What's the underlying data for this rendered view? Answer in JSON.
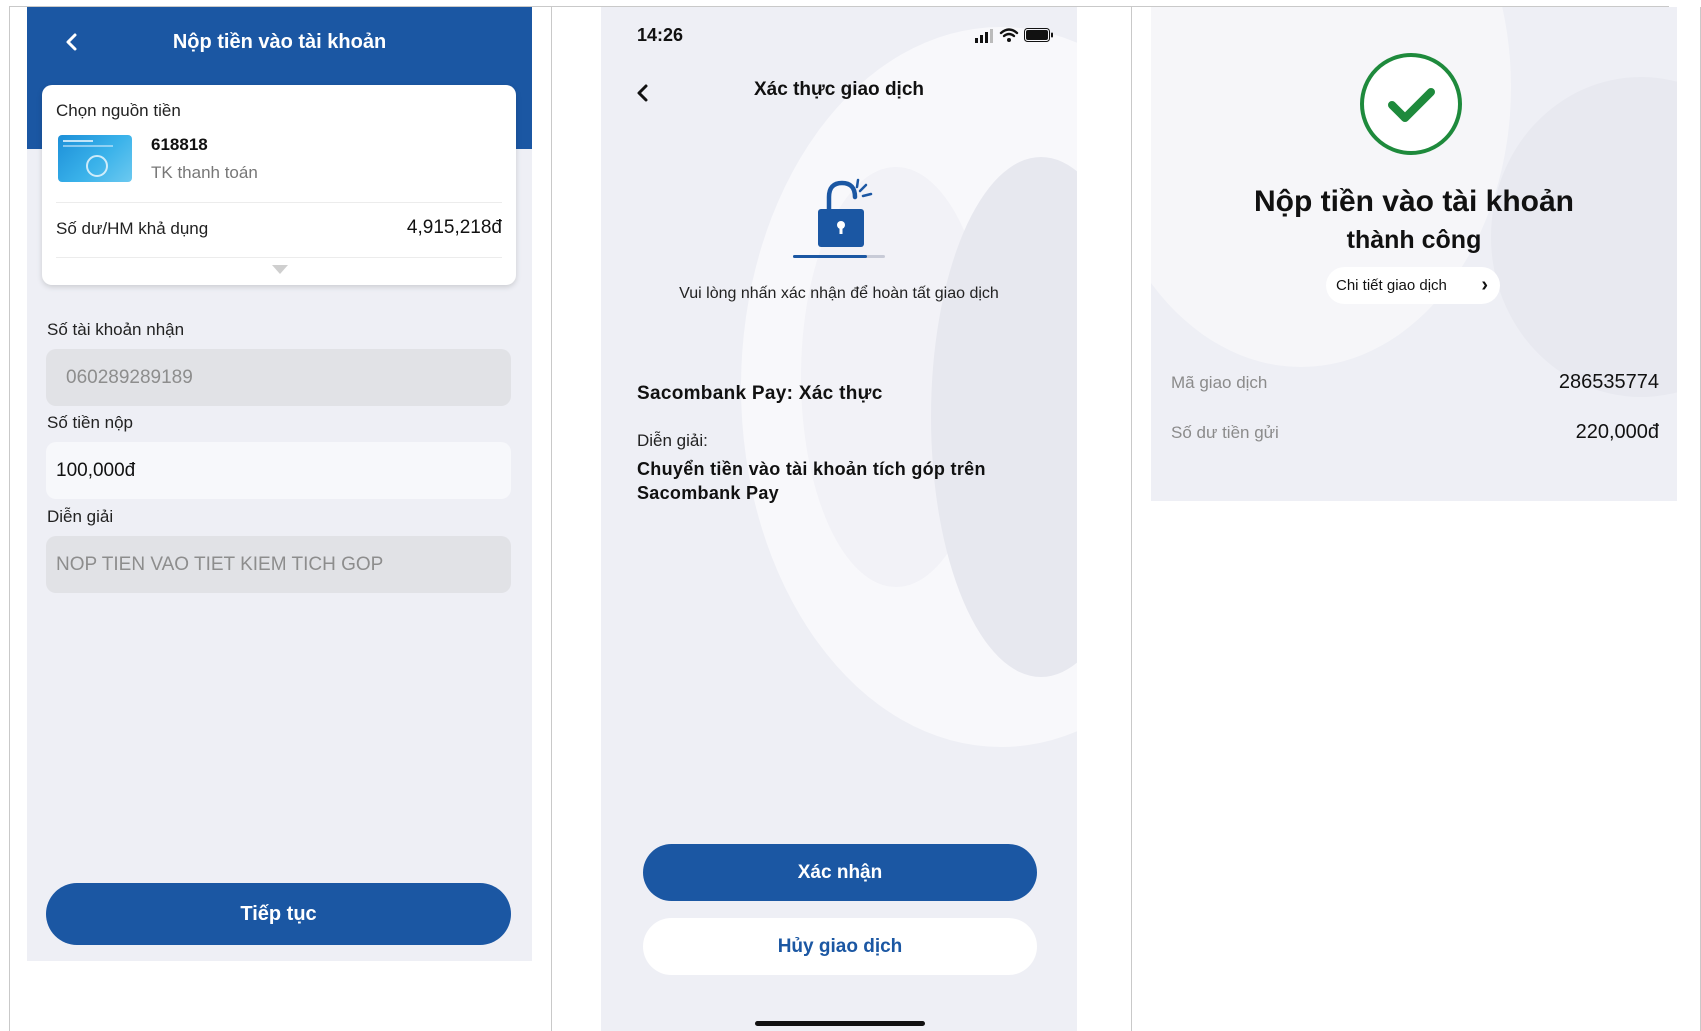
{
  "deposit_form": {
    "title": "Nộp tiền vào tài khoản",
    "back_icon": "chevron-left-icon",
    "source": {
      "label": "Chọn nguồn tiền",
      "account_number": "618818",
      "account_type": "TK thanh toán",
      "balance_label": "Số dư/HM khả dụng",
      "balance_value": "4,915,218đ"
    },
    "receiver_label": "Số tài khoản nhận",
    "receiver_value": "060289289189",
    "amount_label": "Số tiền nộp",
    "amount_value": "100,000đ",
    "note_label": "Diễn giải",
    "note_value": "NOP TIEN VAO TIET KIEM TICH GOP",
    "continue_button": "Tiếp tục"
  },
  "verify": {
    "status_time": "14:26",
    "title": "Xác thực giao dịch",
    "message": "Vui lòng nhấn xác nhận để hoàn tất giao dịch",
    "heading": "Sacombank Pay: Xác thực",
    "desc_label": "Diễn giải:",
    "desc_value": "Chuyển tiền vào tài khoản tích góp trên Sacombank Pay",
    "confirm_button": "Xác nhận",
    "cancel_button": "Hủy giao dịch"
  },
  "success": {
    "title": "Nộp tiền vào tài khoản",
    "subtitle": "thành công",
    "details_button": "Chi tiết giao dịch",
    "rows": [
      {
        "label": "Mã giao dịch",
        "value": "286535774"
      },
      {
        "label": "Số dư tiền gửi",
        "value": "220,000đ"
      }
    ]
  },
  "colors": {
    "primary": "#1b57a3",
    "background": "#eeeff5",
    "success": "#1e8a3c"
  }
}
